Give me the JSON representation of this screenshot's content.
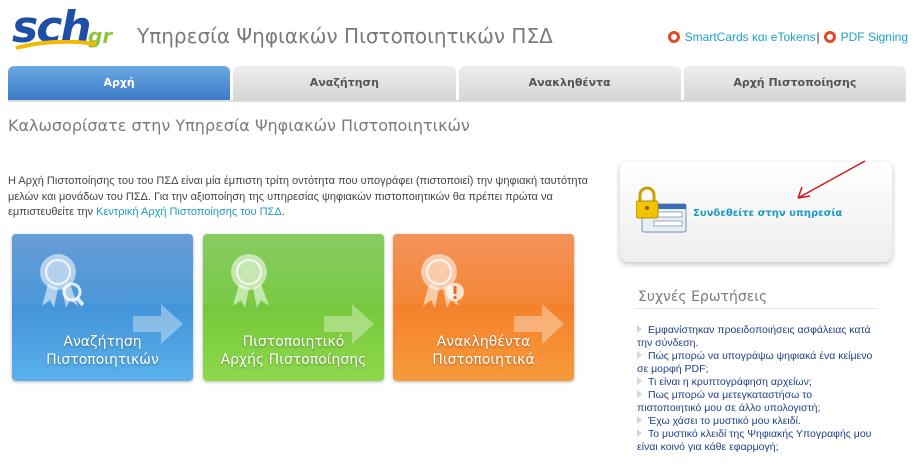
{
  "header": {
    "logo_text": "sch",
    "logo_suffix": "gr",
    "title": "Υπηρεσία Ψηφιακών Πιστοποιητικών ΠΣΔ",
    "links": [
      {
        "label": "SmartCards και eTokens",
        "icon": "lifebuoy-icon"
      },
      {
        "label": "PDF Signing",
        "icon": "lifebuoy-icon"
      }
    ],
    "separator": "|"
  },
  "tabs": [
    {
      "label": "Αρχή",
      "active": true
    },
    {
      "label": "Αναζήτηση",
      "active": false
    },
    {
      "label": "Ανακληθέντα",
      "active": false
    },
    {
      "label": "Αρχή Πιστοποίησης",
      "active": false
    }
  ],
  "main": {
    "welcome": "Καλωσορίσατε στην Υπηρεσία Ψηφιακών Πιστοποιητικών",
    "intro_text": "Η Αρχή Πιστοποίησης του του ΠΣΔ είναι μία έμπιστη τρίτη οντότητα που υπογράφει (πιστοποιεί) την ψηφιακή ταυτότητα μελών και μονάδων του ΠΣΔ. Για την αξιοποίηση της υπηρεσίας ψηφιακών πιστοποιητικών θα πρέπει πρώτα να εμπιστευθείτε την",
    "intro_link": "Κεντρική Αρχή Πιστοποίησης του ΠΣΔ",
    "intro_end": "."
  },
  "tiles": [
    {
      "line1": "Αναζήτηση",
      "line2": "Πιστοποιητικών",
      "color": "#2d78c8",
      "icon": "certificate-search-icon"
    },
    {
      "line1": "Πιστοποιητικό",
      "line2": "Αρχής Πιστοποίησης",
      "color": "#5cb82a",
      "icon": "certificate-icon"
    },
    {
      "line1": "Ανακληθέντα",
      "line2": "Πιστοποιητικά",
      "color": "#f06a1c",
      "icon": "certificate-warning-icon"
    }
  ],
  "login": {
    "label": "Συνδεθείτε στην υπηρεσία",
    "icon": "lock-login-icon"
  },
  "faq": {
    "title": "Συχνές Ερωτήσεις",
    "items": [
      "Εμφανίστηκαν προειδοποιήσεις ασφάλειας κατά την σύνδεση.",
      "Πώς μπορώ να υπογράψω ψηφιακά ένα κείμενο σε μορφή PDF;",
      "Τι είναι η κρυπτογράφηση αρχείων;",
      "Πως μπορώ να μετεγκαταστήσω το πιστοποιητικό μου σε άλλο υπολογιστή;",
      "Έχω χάσει το μυστικό μου κλειδί.",
      "Το μυστικό κλειδί της Ψηφιακής Υπογραφής μου είναι κοινό για κάθε εφαρμογή;"
    ]
  },
  "colors": {
    "accent": "#1aa3c8",
    "tab_active": "#3b7bc9",
    "faq_link": "#1d3f8a"
  }
}
